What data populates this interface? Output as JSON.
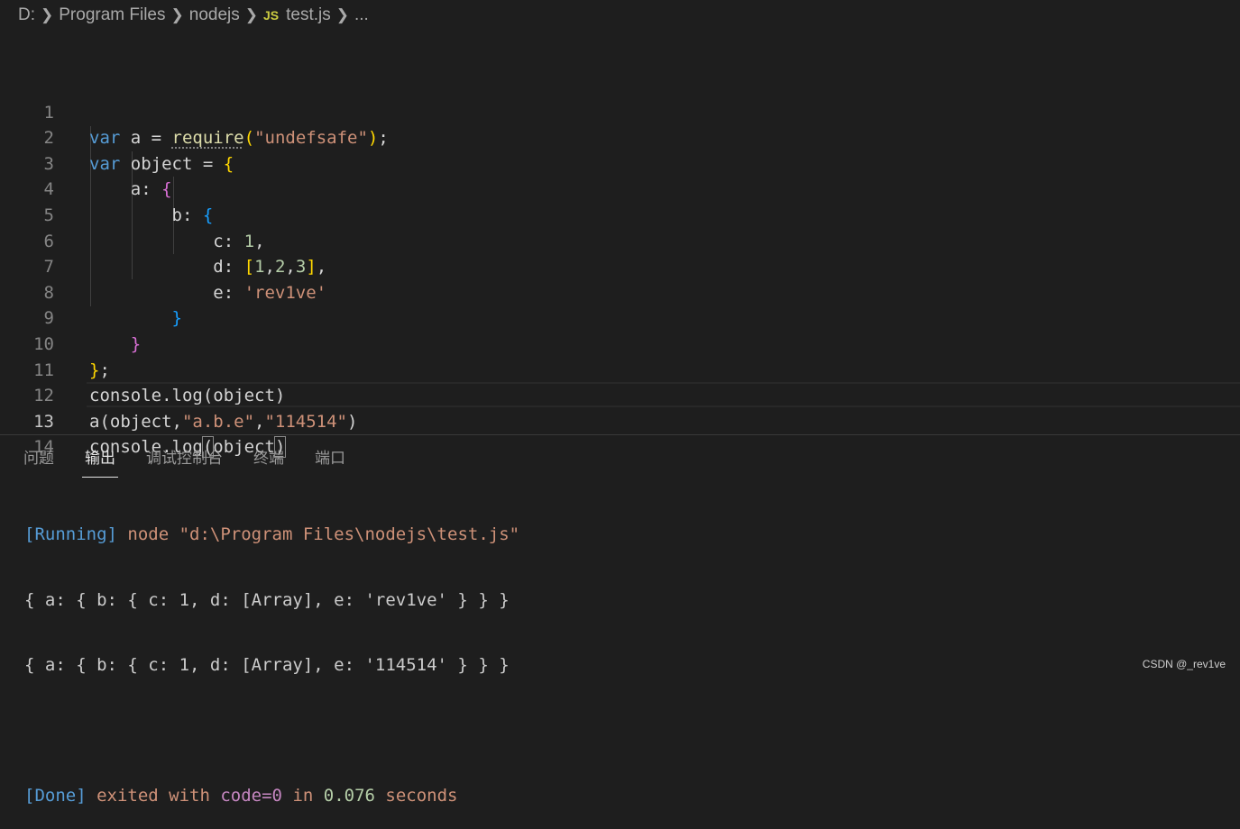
{
  "breadcrumb": {
    "items": [
      "D:",
      "Program Files",
      "nodejs",
      "test.js",
      "..."
    ],
    "file_icon": "JS"
  },
  "editor": {
    "active_line": 13,
    "lines": [
      {
        "no": "1"
      },
      {
        "no": "2"
      },
      {
        "no": "3"
      },
      {
        "no": "4"
      },
      {
        "no": "5"
      },
      {
        "no": "6"
      },
      {
        "no": "7"
      },
      {
        "no": "8"
      },
      {
        "no": "9"
      },
      {
        "no": "10"
      },
      {
        "no": "11"
      },
      {
        "no": "12"
      },
      {
        "no": "13"
      },
      {
        "no": "14"
      }
    ],
    "code": {
      "l1_kw": "var",
      "l1_rest": " a = ",
      "l1_fn": "require",
      "l1_str": "\"undefsafe\"",
      "l2_kw": "var",
      "l2_rest": " object = ",
      "l3_key": "a: ",
      "l4_key": "b: ",
      "l5_key": "c: ",
      "l5_num": "1",
      "l6_key": "d: ",
      "l6_n1": "1",
      "l6_n2": "2",
      "l6_n3": "3",
      "l7_key": "e: ",
      "l7_str": "'rev1ve'",
      "l11": "console.log(object)",
      "l12_pre": "a(object,",
      "l12_s1": "\"a.b.e\"",
      "l12_s2": "\"114514\"",
      "l13_pre": "console.log",
      "l13_arg": "object"
    }
  },
  "panel": {
    "tabs": [
      {
        "label": "问题",
        "active": false
      },
      {
        "label": "输出",
        "active": true
      },
      {
        "label": "调试控制台",
        "active": false
      },
      {
        "label": "终端",
        "active": false
      },
      {
        "label": "端口",
        "active": false
      }
    ],
    "output": {
      "running_tag": "[Running]",
      "running_cmd": " node \"d:\\Program Files\\nodejs\\test.js\"",
      "line1": "{ a: { b: { c: 1, d: [Array], e: 'rev1ve' } } }",
      "line2": "{ a: { b: { c: 1, d: [Array], e: '114514' } } }",
      "done_tag": "[Done]",
      "done_exited": " exited with ",
      "done_code": "code=0",
      "done_in": " in ",
      "done_time": "0.076",
      "done_seconds": " seconds"
    }
  },
  "watermark": "CSDN @_rev1ve",
  "colors": {
    "background": "#1e1e1e",
    "keyword": "#569cd6",
    "string": "#ce9178",
    "number": "#b5cea8",
    "bracket_gold": "#ffd700",
    "bracket_purple": "#da70d6",
    "bracket_blue": "#179fff"
  }
}
